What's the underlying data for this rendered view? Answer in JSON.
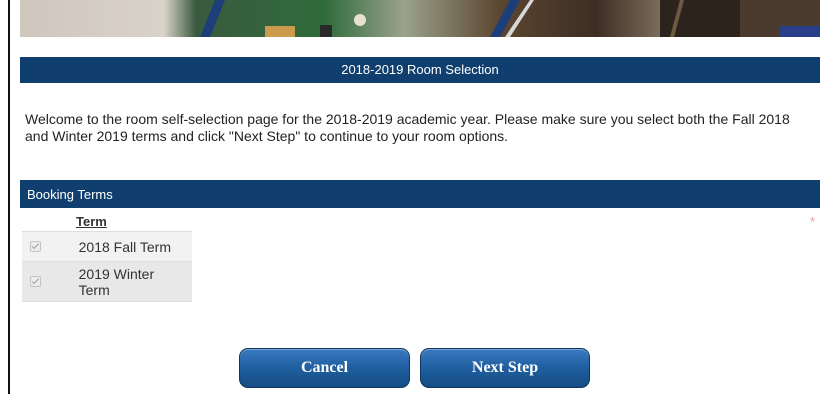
{
  "banner": {
    "alt": "header photo banner"
  },
  "page_header": {
    "title": "2018-2019 Room Selection"
  },
  "intro": {
    "text": "Welcome to the room self-selection page for the 2018-2019 academic year.  Please make sure you select both the Fall 2018 and Winter 2019 terms and click \"Next Step\" to continue to your room options."
  },
  "booking_terms": {
    "header": "Booking Terms",
    "required_marker": "*",
    "column_header": "Term",
    "rows": [
      {
        "label": "2018 Fall Term",
        "checked": true
      },
      {
        "label": "2019 Winter Term",
        "checked": true
      }
    ]
  },
  "buttons": {
    "cancel_label": "Cancel",
    "next_label": "Next Step"
  },
  "colors": {
    "header_bar": "#103f6f",
    "button": "#1f5e9f",
    "required": "#e89a9a"
  }
}
